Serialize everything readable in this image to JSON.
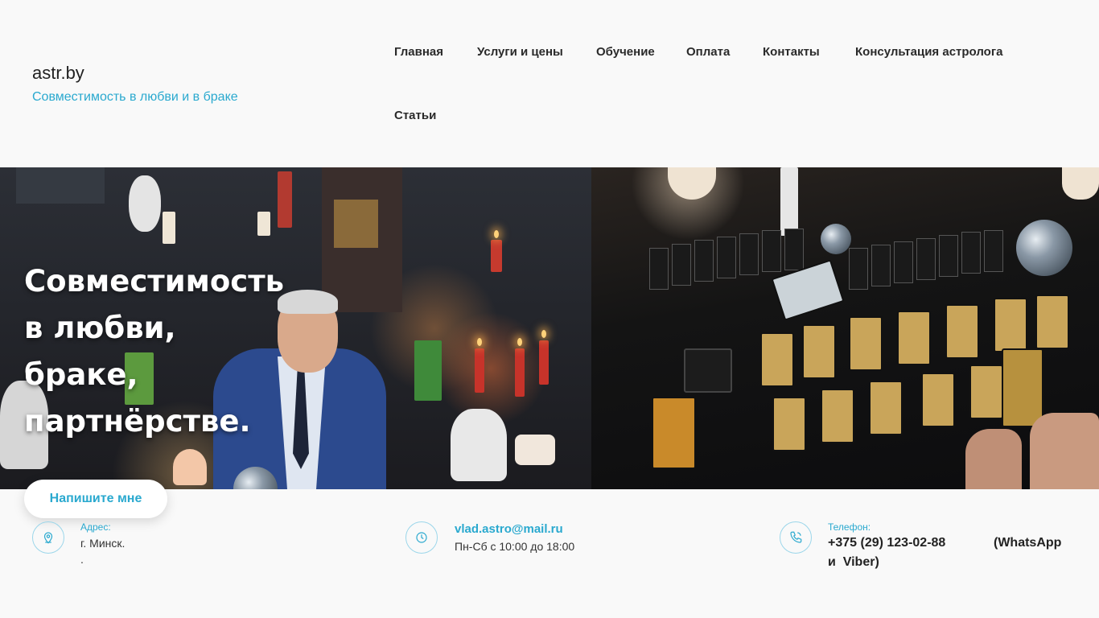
{
  "header": {
    "site_title": "astr.by",
    "tagline": "Совместимость в любви и в браке"
  },
  "nav": {
    "items": [
      {
        "label": "Главная"
      },
      {
        "label": "Услуги и цены"
      },
      {
        "label": "Обучение"
      },
      {
        "label": "Оплата"
      },
      {
        "label": "Контакты"
      },
      {
        "label": "Консультация астролога"
      },
      {
        "label": "Статьи"
      }
    ]
  },
  "hero": {
    "heading_lines": [
      "Совместимость",
      "в любви,",
      "браке,",
      "партнёрстве."
    ],
    "cta_label": "Напишите мне"
  },
  "contacts": {
    "address": {
      "label": "Адрес:",
      "line1": "г. Минск.",
      "line2": "."
    },
    "email": {
      "value": "vlad.astro@mail.ru",
      "hours": "Пн-Сб с 10:00 до 18:00"
    },
    "phone": {
      "label": "Телефон:",
      "number": "+375 (29) 123-02-88",
      "note": "(WhatsApp",
      "note2": "и  Viber)"
    }
  },
  "colors": {
    "accent": "#2aa9cf",
    "page_bg": "#f9f9f9"
  },
  "icons": {
    "address": "location-pin-icon",
    "email": "clock-icon",
    "phone": "phone-icon"
  }
}
